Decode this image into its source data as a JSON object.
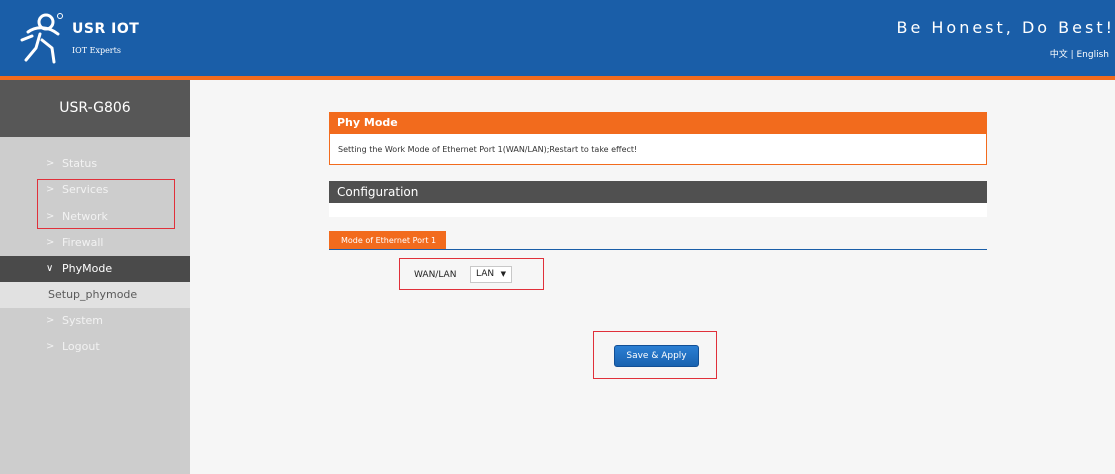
{
  "header": {
    "brand": "USR IOT",
    "brand_sub": "IOT Experts",
    "slogan": "Be Honest, Do Best!",
    "lang_zh": "中文",
    "lang_sep": "|",
    "lang_en": "English"
  },
  "sidebar": {
    "device": "USR-G806",
    "items": [
      {
        "label": "Status",
        "chev": ">"
      },
      {
        "label": "Services",
        "chev": ">"
      },
      {
        "label": "Network",
        "chev": ">"
      },
      {
        "label": "Firewall",
        "chev": ">"
      },
      {
        "label": "PhyMode",
        "chev": "∨"
      },
      {
        "label": "System",
        "chev": ">"
      },
      {
        "label": "Logout",
        "chev": ">"
      }
    ],
    "subitem": "Setup_phymode"
  },
  "main": {
    "panel_title": "Phy Mode",
    "panel_desc": "Setting the Work Mode of Ethernet Port 1(WAN/LAN);Restart to take effect!",
    "config_title": "Configuration",
    "tab_label": "Mode of Ethernet Port 1",
    "field_label": "WAN/LAN",
    "field_value": "LAN",
    "field_arrow": "▼",
    "apply_label": "Save & Apply"
  },
  "colors": {
    "header_blue": "#1a5ea8",
    "accent_orange": "#f26b1d",
    "highlight_red": "#e0303a",
    "sidebar_gray": "#cdcdcd",
    "active_dark": "#4a4a4a"
  }
}
